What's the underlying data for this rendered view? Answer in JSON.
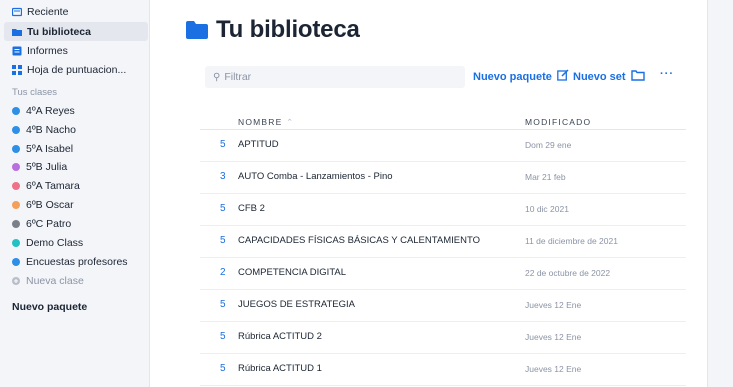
{
  "sidebar": {
    "nav": [
      {
        "label": "Reciente",
        "icon": "recent-icon"
      },
      {
        "label": "Tu biblioteca",
        "icon": "folder-icon",
        "active": true
      },
      {
        "label": "Informes",
        "icon": "reports-icon"
      },
      {
        "label": "Hoja de puntuacion...",
        "icon": "grid-icon"
      }
    ],
    "classes_label": "Tus clases",
    "classes": [
      {
        "label": "4ºA Reyes",
        "color": "#2d8fe6"
      },
      {
        "label": "4ºB Nacho",
        "color": "#2d8fe6"
      },
      {
        "label": "5ºA Isabel",
        "color": "#2d8fe6"
      },
      {
        "label": "5ºB Julia",
        "color": "#b86fe0"
      },
      {
        "label": "6ºA Tamara",
        "color": "#f0708a"
      },
      {
        "label": "6ºB Oscar",
        "color": "#f5a05a"
      },
      {
        "label": "6ºC Patro",
        "color": "#7a7f8a"
      },
      {
        "label": "Demo Class",
        "color": "#22c2c4"
      },
      {
        "label": "Encuestas profesores",
        "color": "#2d8fe6"
      }
    ],
    "new_class": "Nueva clase",
    "new_package": "Nuevo paquete"
  },
  "main": {
    "title": "Tu biblioteca",
    "search_placeholder": "Filtrar",
    "new_package_label": "Nuevo paquete",
    "new_set_label": "Nuevo set",
    "columns": {
      "name": "NOMBRE",
      "modified": "MODIFICADO"
    },
    "rows": [
      {
        "count": "5",
        "name": "APTITUD",
        "date": "Dom 29 ene"
      },
      {
        "count": "3",
        "name": "AUTO Comba - Lanzamientos - Pino",
        "date": "Mar 21 feb"
      },
      {
        "count": "5",
        "name": "CFB 2",
        "date": "10 dic 2021"
      },
      {
        "count": "5",
        "name": "CAPACIDADES FÍSICAS BÁSICAS Y CALENTAMIENTO",
        "date": "11 de diciembre de 2021"
      },
      {
        "count": "2",
        "name": "COMPETENCIA DIGITAL",
        "date": "22 de octubre de 2022"
      },
      {
        "count": "5",
        "name": "JUEGOS DE ESTRATEGIA",
        "date": "Jueves 12 Ene"
      },
      {
        "count": "5",
        "name": "Rúbrica ACTITUD 2",
        "date": "Jueves 12 Ene"
      },
      {
        "count": "5",
        "name": "Rúbrica ACTITUD 1",
        "date": "Jueves 12 Ene"
      }
    ]
  },
  "colors": {
    "accent": "#1a6fe3",
    "sidebar_bg": "#f4f5f9"
  }
}
